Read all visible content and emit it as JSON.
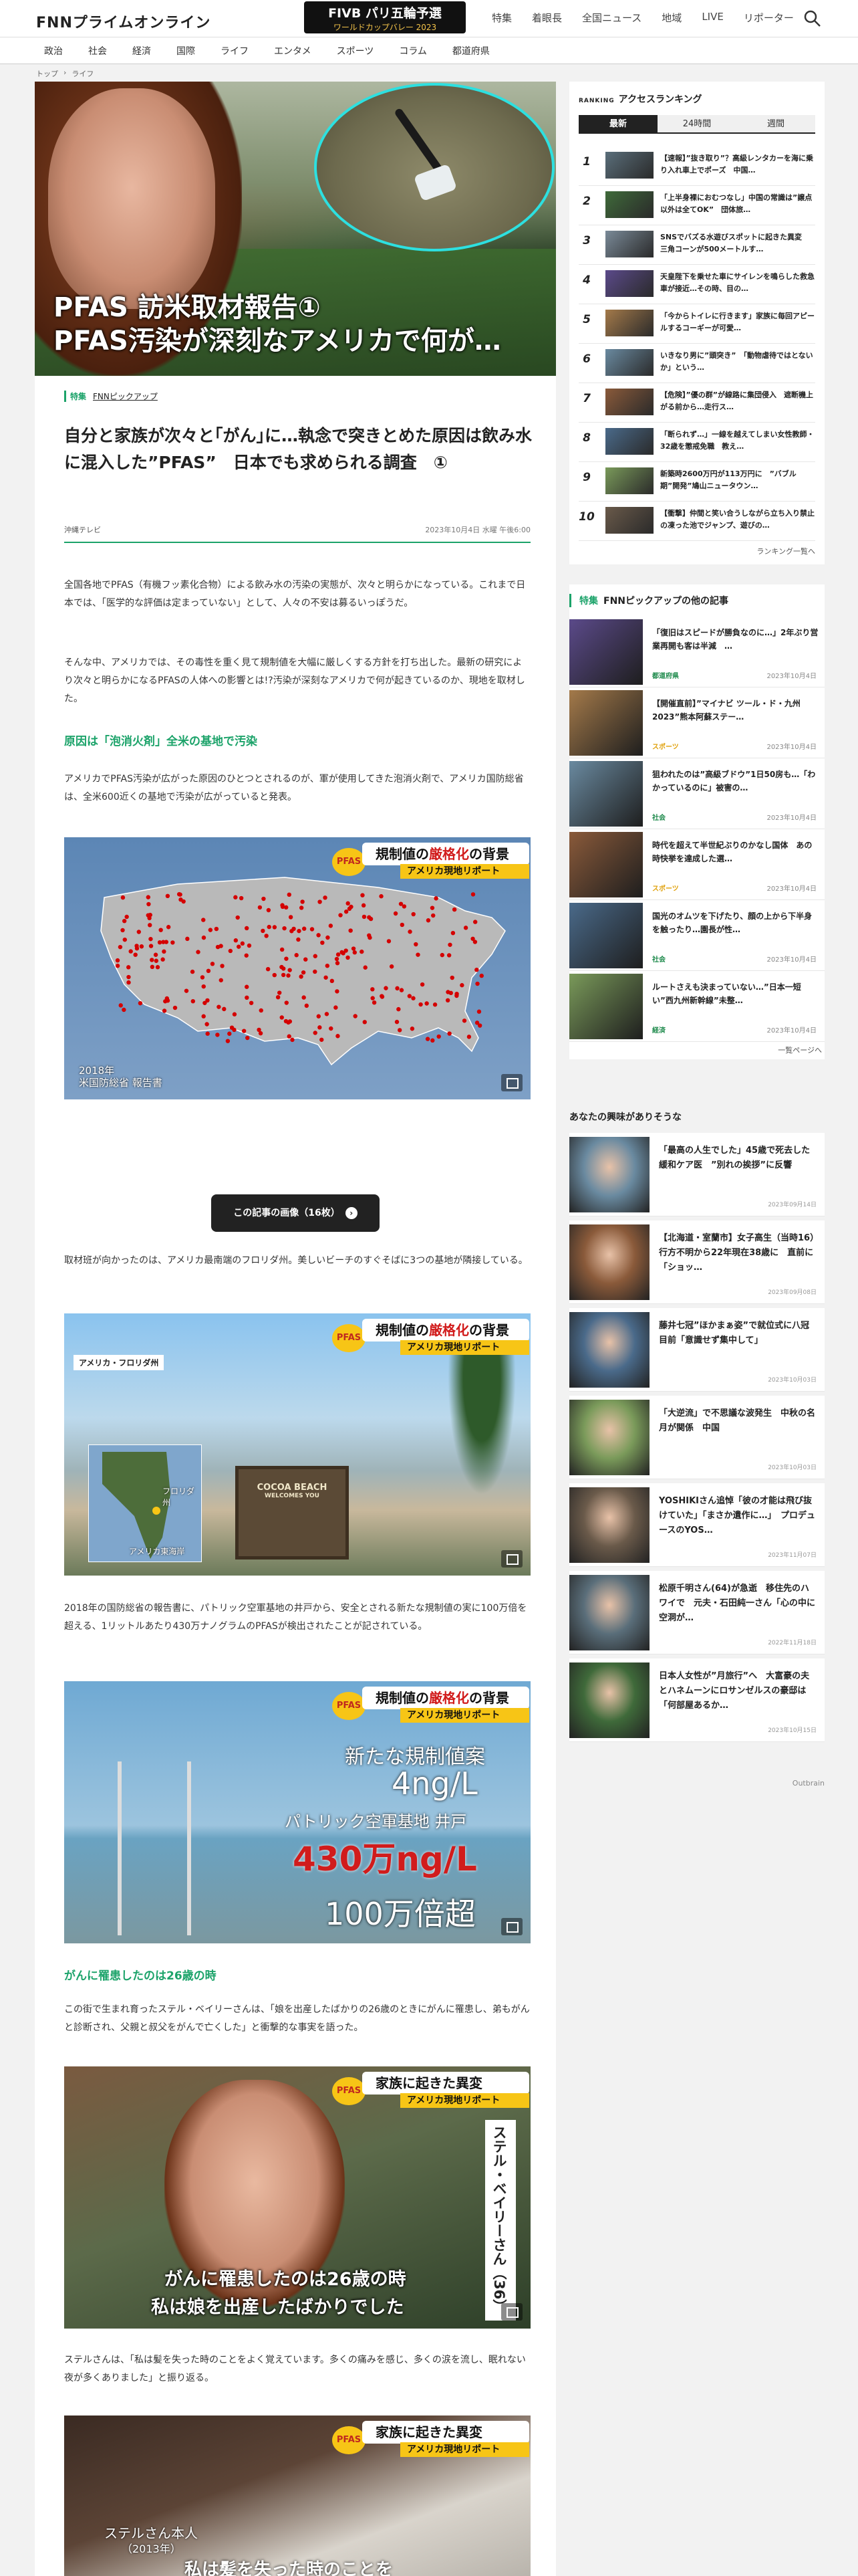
{
  "header": {
    "logo": "FNNプライムオンライン",
    "banner": {
      "line1": "FIVB パリ五輪予選",
      "line2": "ワールドカップバレー 2023"
    },
    "nav": [
      "特集",
      "着眼長",
      "全国ニュース",
      "地域",
      "LIVE",
      "リポーター"
    ]
  },
  "subnav": [
    "政治",
    "社会",
    "経済",
    "国際",
    "ライフ",
    "エンタメ",
    "スポーツ",
    "コラム",
    "都道府県"
  ],
  "breadcrumb": [
    "トップ",
    "ライフ"
  ],
  "article": {
    "hero": {
      "line1": "PFAS 訪米取材報告①",
      "line2": "PFAS汚染が深刻なアメリカで何が…"
    },
    "category": "特集",
    "pickup": "FNNピックアップ",
    "title": "自分と家族が次々と｢がん｣に…執念で突きとめた原因は飲み水に混入した”PFAS”　日本でも求められる調査　①",
    "source": "沖縄テレビ",
    "date": "2023年10月4日 水曜 午後6:00",
    "p1": "全国各地でPFAS（有機フッ素化合物）による飲み水の汚染の実態が、次々と明らかになっている。これまで日本では、「医学的な評価は定まっていない」として、人々の不安は募るいっぽうだ。",
    "p2": "そんな中、アメリカでは、その毒性を重く見て規制値を大幅に厳しくする方針を打ち出した。最新の研究により次々と明らかになるPFASの人体への影響とは!?汚染が深刻なアメリカで何が起きているのか、現地を取材した。",
    "h2a": "原因は「泡消火剤」全米の基地で汚染",
    "p3": "アメリカでPFAS汚染が広がった原因のひとつとされるのが、軍が使用してきた泡消火剤で、アメリカ国防総省は、全米600近くの基地で汚染が広がっていると発表。",
    "fig1": {
      "tag1a": "規制値の",
      "tag1b": "厳格化",
      "tag1c": "の背景",
      "tag2": "アメリカ現地リポート",
      "caption": "2018年\n米国防総省 報告書",
      "badge": "PFAS"
    },
    "gallery": "この記事の画像（16枚）",
    "p4": "取材班が向かったのは、アメリカ最南端のフロリダ州。美しいビーチのすぐそばに3つの基地が隣接している。",
    "fig2": {
      "label": "アメリカ・フロリダ州",
      "map1": "フロリダ州",
      "map2": "アメリカ東海岸",
      "sign1": "COCOA BEACH",
      "sign2": "WELCOMES YOU"
    },
    "p5": "2018年の国防総省の報告書に、パトリック空軍基地の井戸から、安全とされる新たな規制値の実に100万倍を超える、1リットルあたり430万ナノグラムのPFASが検出されたことが記されている。",
    "fig3": {
      "r1": "新たな規制値案",
      "r2": "4ng/L",
      "r3": "パトリック空軍基地 井戸",
      "r4": "430万ng/L",
      "r5": "100万倍超"
    },
    "h2b": "がんに罹患したのは26歳の時",
    "p6": "この街で生まれ育ったステル・ベイリーさんは、「娘を出産したばかりの26歳のときにがんに罹患し、弟もがんと診断され、父親と叔父をがんで亡くした」と衝撃的な事実を語った。",
    "fig4": {
      "tag1": "家族に起きた異変",
      "name": "ステル・ベイリーさん（36）",
      "sub1": "がんに罹患したのは26歳の時",
      "sub2": "私は娘を出産したばかりでした"
    },
    "p7": "ステルさんは、「私は髪を失った時のことをよく覚えています。多くの痛みを感じ、多くの涙を流し、眠れない夜が多くありました」と振り返る。",
    "fig5": {
      "tag1": "家族に起きた異変",
      "name": "ステルさん本人",
      "year": "（2013年）",
      "sub": "私は髪を失った時のことを"
    }
  },
  "sidebar": {
    "ranking": {
      "label": "RANKING",
      "title": "アクセスランキング",
      "tabs": [
        "最新",
        "24時間",
        "週間"
      ],
      "more": "ランキング一覧へ",
      "items": [
        {
          "n": "1",
          "t": "【速報】”抜き取り”？高級レンタカーを海に乗り入れ車上でポーズ　中国…"
        },
        {
          "n": "2",
          "t": "「上半身裸におむつなし」中国の常識は”譲点以外は全てOK”　団体旅…"
        },
        {
          "n": "3",
          "t": "SNSでバズる水遊びスポットに起きた異変　三角コーンが500メートルす…"
        },
        {
          "n": "4",
          "t": "天皇陛下を乗せた車にサイレンを鳴らした救急車が接近…その時、目の…"
        },
        {
          "n": "5",
          "t": "「今からトイレに行きます」家族に毎回アピールするコーギーが可愛…"
        },
        {
          "n": "6",
          "t": "いきなり男に”頭突き”　「動物虐待ではとないか」という…"
        },
        {
          "n": "7",
          "t": "【危険】”優の群”が線路に集団侵入　遮断機上がる前から…走行ス…"
        },
        {
          "n": "8",
          "t": "「断られず…」一線を越えてしまい女性教師・32歳を懲戒免職　教え…"
        },
        {
          "n": "9",
          "t": "新築時2600万円が113万円に　”バブル期”開発”鳩山ニュータウン…"
        },
        {
          "n": "10",
          "t": "【衝撃】仲間と笑い合うしながら立ち入り禁止の凍った池でジャンプ、遊びの…"
        }
      ]
    },
    "pickup": {
      "token": "特集",
      "title": "FNNピックアップの他の記事",
      "more": "一覧ページへ",
      "items": [
        {
          "t": "「復旧はスピードが勝負なのに…」2年ぶり営業再開も客は半減　…",
          "c": "都道府県",
          "d": "2023年10月4日"
        },
        {
          "t": "【開催直前】”マイナビ ツール・ド・九州2023”熊本阿蘇ステー…",
          "c": "スポーツ",
          "d": "2023年10月4日"
        },
        {
          "t": "狙われたのは”高級ブドウ”1日50房も…「わかっているのに」被害の…",
          "c": "社会",
          "d": "2023年10月4日"
        },
        {
          "t": "時代を超えて半世紀ぶりのかなし国体　あの時快挙を達成した選…",
          "c": "スポーツ",
          "d": "2023年10月4日"
        },
        {
          "t": "国光のオムツを下げたり、顔の上から下半身を触ったり…園長が性…",
          "c": "社会",
          "d": "2023年10月4日"
        },
        {
          "t": "ルートさえも決まっていない…”日本一短い”西九州新幹線”未整…",
          "c": "経済",
          "d": "2023年10月4日"
        }
      ]
    },
    "rec": {
      "title": "あなたの興味がありそうな",
      "items": [
        {
          "t": "「最高の人生でした」45歳で死去した緩和ケア医　”別れの挨拶”に反響",
          "d": "2023年09月14日"
        },
        {
          "t": "【北海道・室蘭市】女子高生（当時16）行方不明から22年現在38歳に　直前に「ショッ…",
          "d": "2023年09月08日"
        },
        {
          "t": "藤井七冠”ほかまぁ姿”で就位式に八冠目前「意識せず集中して」",
          "d": "2023年10月03日"
        },
        {
          "t": "「大逆流」で不思議な波発生　中秋の名月が関係　中国",
          "d": "2023年10月03日"
        },
        {
          "t": "YOSHIKIさん追悼「彼の才能は飛び抜けていた」「まさか遺作に…」　プロデュースのYOS…",
          "d": "2023年11月07日"
        },
        {
          "t": "松原千明さん(64)が急逝　移住先のハワイで　元夫・石田純一さん「心の中に空洞が…",
          "d": "2022年11月18日"
        },
        {
          "t": "日本人女性が”月旅行”へ　大富豪の夫とハネムーンにロサンゼルスの豪邸は「何部屋あるか…",
          "d": "2023年10月15日"
        }
      ]
    },
    "outbrain": "Outbrain"
  },
  "colors": {
    "accent": "#1ca36a",
    "tag_yellow": "#f7c516",
    "alert_red": "#d11c1c",
    "dark": "#222222"
  }
}
